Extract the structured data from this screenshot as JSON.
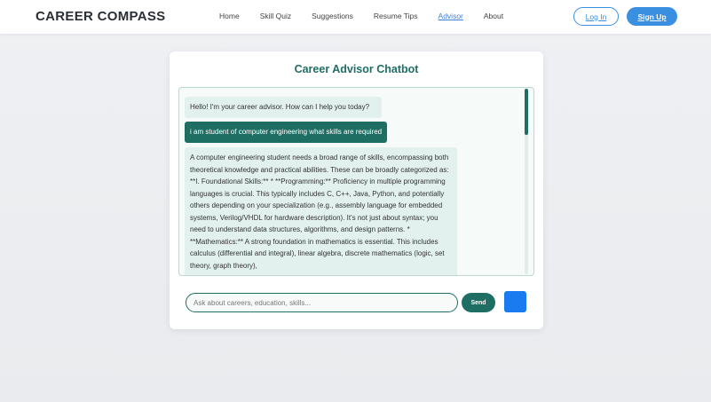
{
  "header": {
    "brand": "CAREER COMPASS",
    "nav": [
      {
        "label": "Home",
        "active": false
      },
      {
        "label": "Skill Quiz",
        "active": false
      },
      {
        "label": "Suggestions",
        "active": false
      },
      {
        "label": "Resume Tips",
        "active": false
      },
      {
        "label": "Advisor",
        "active": true
      },
      {
        "label": "About",
        "active": false
      }
    ],
    "login_label": "Log In",
    "signup_label": "Sign Up"
  },
  "chat": {
    "title": "Career Advisor Chatbot",
    "messages": [
      {
        "role": "bot",
        "text": "Hello! I'm your career advisor. How can I help you today?"
      },
      {
        "role": "user",
        "text": "i am student of computer engineering what skills are required"
      },
      {
        "role": "bot",
        "text": "A computer engineering student needs a broad range of skills, encompassing both theoretical knowledge and practical abilities. These can be broadly categorized as: **I. Foundational Skills:** * **Programming:** Proficiency in multiple programming languages is crucial. This typically includes C, C++, Java, Python, and potentially others depending on your specialization (e.g., assembly language for embedded systems, Verilog/VHDL for hardware description). It's not just about syntax; you need to understand data structures, algorithms, and design patterns. * **Mathematics:** A strong foundation in mathematics is essential. This includes calculus (differential and integral), linear algebra, discrete mathematics (logic, set theory, graph theory),"
      }
    ],
    "input_placeholder": "Ask about careers, education, skills...",
    "send_label": "Send"
  },
  "colors": {
    "accent": "#1f6e64",
    "brand_blue": "#3b8fe0",
    "mic_blue": "#1a7bf0"
  }
}
